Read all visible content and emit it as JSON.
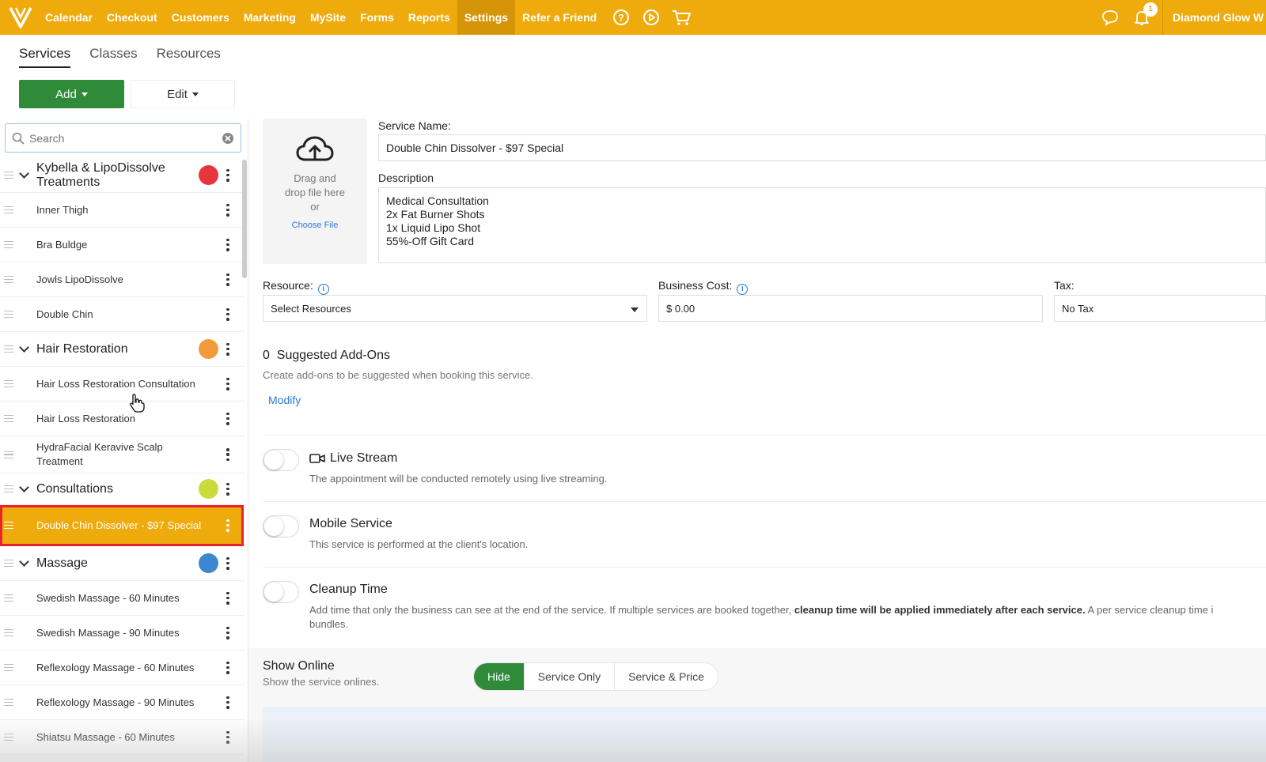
{
  "nav": {
    "items": [
      "Calendar",
      "Checkout",
      "Customers",
      "Marketing",
      "MySite",
      "Forms",
      "Reports",
      "Settings",
      "Refer a Friend"
    ],
    "active": "Settings",
    "notification_count": "1",
    "account": "Diamond Glow W"
  },
  "subtabs": [
    "Services",
    "Classes",
    "Resources"
  ],
  "toolbar": {
    "add_label": "Add",
    "edit_label": "Edit"
  },
  "search": {
    "placeholder": "Search"
  },
  "categories": [
    {
      "name": "Kybella & LipoDissolve Treatments",
      "color": "#e8353d",
      "items": [
        "Inner Thigh",
        "Bra Buldge",
        "Jowls LipoDissolve",
        "Double Chin"
      ]
    },
    {
      "name": "Hair Restoration",
      "color": "#f39a3a",
      "items": [
        "Hair Loss Restoration Consultation",
        "Hair Loss Restoration",
        "HydraFacial Keravive Scalp Treatment"
      ]
    },
    {
      "name": "Consultations",
      "color": "#c8dc3c",
      "items": [
        "Double Chin Dissolver - $97 Special"
      ]
    },
    {
      "name": "Massage",
      "color": "#3d87cf",
      "items": [
        "Swedish Massage - 60 Minutes",
        "Swedish Massage - 90 Minutes",
        "Reflexology Massage - 60 Minutes",
        "Reflexology Massage - 90 Minutes",
        "Shiatsu Massage - 60 Minutes"
      ]
    }
  ],
  "selected_item": "Double Chin Dissolver - $97 Special",
  "upload": {
    "line1": "Drag and",
    "line2": "drop file here",
    "line3": "or",
    "choose": "Choose File"
  },
  "form": {
    "service_name_label": "Service Name:",
    "service_name_value": "Double Chin Dissolver - $97 Special",
    "description_label": "Description",
    "description_lines": [
      "Medical Consultation",
      "2x Fat Burner Shots",
      "1x Liquid Lipo Shot",
      "55%-Off Gift Card"
    ],
    "resource_label": "Resource:",
    "resource_value": "Select Resources",
    "business_cost_label": "Business Cost:",
    "business_cost_value": "$ 0.00",
    "tax_label": "Tax:",
    "tax_value": "No Tax"
  },
  "addons": {
    "title": "0  Suggested Add-Ons",
    "subtitle": "Create add-ons to be suggested when booking this service.",
    "modify": "Modify"
  },
  "options": {
    "live_stream": {
      "title": "Live Stream",
      "desc": "The appointment will be conducted remotely using live streaming."
    },
    "mobile": {
      "title": "Mobile Service",
      "desc": "This service is performed at the client's location."
    },
    "cleanup": {
      "title": "Cleanup Time",
      "desc_a": "Add time that only the business can see at the end of the service. If multiple services are booked together,",
      "desc_b": "cleanup time will be applied immediately after each service.",
      "desc_c": "A per service cleanup time i",
      "desc_d": "bundles."
    }
  },
  "show_online": {
    "title": "Show Online",
    "subtitle": "Show the service onlines.",
    "options": [
      "Hide",
      "Service Only",
      "Service & Price"
    ],
    "selected": "Hide"
  }
}
